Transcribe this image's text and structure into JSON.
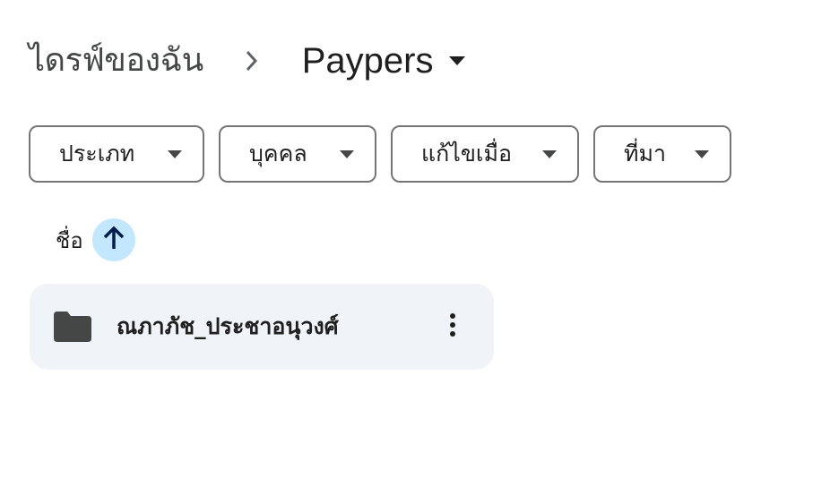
{
  "breadcrumb": {
    "root": "ไดรฟ์ของฉัน",
    "separator_icon": "chevron-right-icon",
    "current": "Paypers",
    "current_caret_icon": "caret-down-icon"
  },
  "filters": [
    {
      "label": "ประเภท",
      "icon": "caret-down-icon"
    },
    {
      "label": "บุคคล",
      "icon": "caret-down-icon"
    },
    {
      "label": "แก้ไขเมื่อ",
      "icon": "caret-down-icon"
    },
    {
      "label": "ที่มา",
      "icon": "caret-down-icon"
    }
  ],
  "sort": {
    "label": "ชื่อ",
    "direction_icon": "arrow-up-icon"
  },
  "items": [
    {
      "name": "ณภาภัช_ประชาอนุวงศ์",
      "icon": "folder-icon",
      "menu_icon": "more-vert-icon"
    }
  ],
  "colors": {
    "sort_button_bg": "#c2e7ff",
    "arrow": "#0b57d0",
    "item_bg": "#f0f4f9",
    "chip_border": "#747775"
  }
}
